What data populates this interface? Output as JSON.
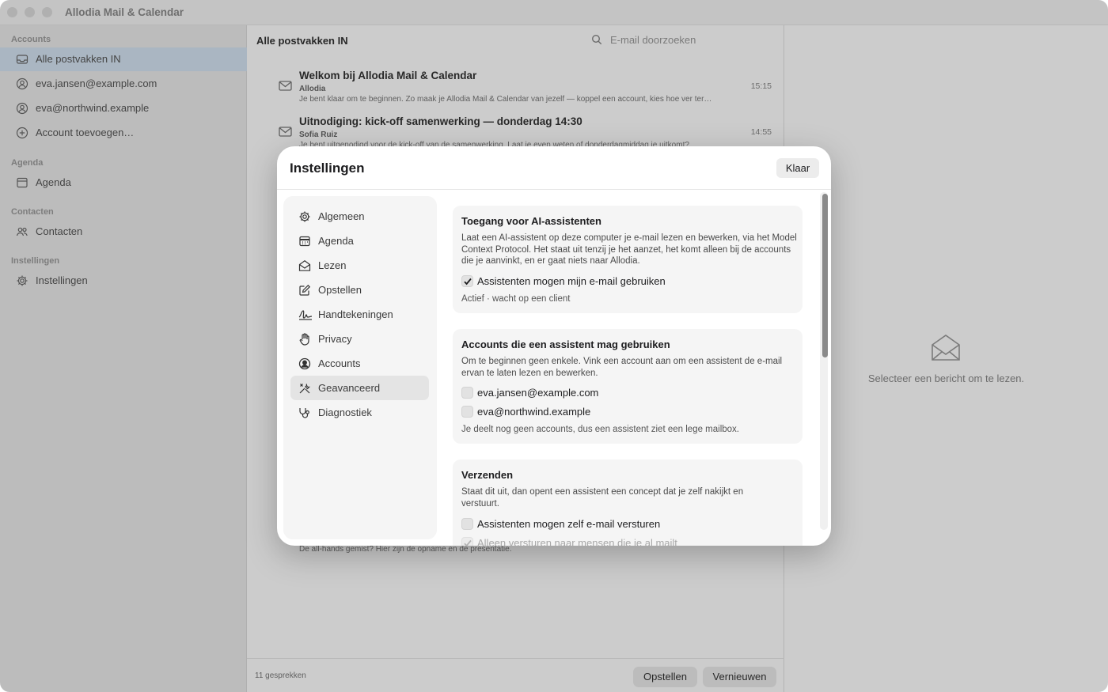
{
  "window": {
    "title": "Allodia Mail & Calendar"
  },
  "sidebar": {
    "sections": [
      {
        "label": "Accounts",
        "items": [
          {
            "label": "Alle postvakken IN",
            "icon": "inbox-icon",
            "selected": true
          },
          {
            "label": "eva.jansen@example.com",
            "icon": "person-icon"
          },
          {
            "label": "eva@northwind.example",
            "icon": "person-icon"
          },
          {
            "label": "Account toevoegen…",
            "icon": "plus-circle-icon"
          }
        ]
      },
      {
        "label": "Agenda",
        "items": [
          {
            "label": "Agenda",
            "icon": "calendar-icon"
          }
        ]
      },
      {
        "label": "Contacten",
        "items": [
          {
            "label": "Contacten",
            "icon": "people-icon"
          }
        ]
      },
      {
        "label": "Instellingen",
        "items": [
          {
            "label": "Instellingen",
            "icon": "gear-icon"
          }
        ]
      }
    ]
  },
  "list": {
    "title": "Alle postvakken IN",
    "search_placeholder": "E-mail doorzoeken",
    "messages": [
      {
        "subject": "Welkom bij Allodia Mail & Calendar",
        "from": "Allodia",
        "preview": "Je bent klaar om te beginnen. Zo maak je Allodia Mail & Calendar van jezelf — koppel een account, kies hoe ver ter…",
        "time": "15:15"
      },
      {
        "subject": "Uitnodiging: kick-off samenwerking — donderdag 14:30",
        "from": "Sofia Ruiz",
        "preview": "Je bent uitgenodigd voor de kick-off van de samenwerking. Laat je even weten of donderdagmiddag je uitkomt?",
        "time": "14:55"
      }
    ],
    "last_preview": "De all-hands gemist? Hier zijn de opname en de presentatie.",
    "count": "11 gesprekken",
    "compose_label": "Opstellen",
    "refresh_label": "Vernieuwen"
  },
  "reader": {
    "empty_label": "Selecteer een bericht om te lezen.",
    "icon": "open-envelope-icon"
  },
  "settings": {
    "title": "Instellingen",
    "done_label": "Klaar",
    "nav": [
      {
        "label": "Algemeen",
        "icon": "gear-icon"
      },
      {
        "label": "Agenda",
        "icon": "calendar-icon"
      },
      {
        "label": "Lezen",
        "icon": "open-envelope-icon"
      },
      {
        "label": "Opstellen",
        "icon": "compose-icon"
      },
      {
        "label": "Handtekeningen",
        "icon": "signature-icon"
      },
      {
        "label": "Privacy",
        "icon": "hand-icon"
      },
      {
        "label": "Accounts",
        "icon": "person-circle-icon"
      },
      {
        "label": "Geavanceerd",
        "icon": "tools-icon",
        "selected": true
      },
      {
        "label": "Diagnostiek",
        "icon": "stethoscope-icon"
      }
    ],
    "cards": {
      "ai_access": {
        "title": "Toegang voor AI-assistenten",
        "desc": "Laat een AI-assistent op deze computer je e-mail lezen en bewerken, via het Model Context Protocol. Het staat uit tenzij je het aanzet, het komt alleen bij de accounts die je aanvinkt, en er gaat niets naar Allodia.",
        "checkbox_label": "Assistenten mogen mijn e-mail gebruiken",
        "checkbox_checked": true,
        "status": "Actief · wacht op een client"
      },
      "accounts": {
        "title": "Accounts die een assistent mag gebruiken",
        "desc": "Om te beginnen geen enkele. Vink een account aan om een assistent de e-mail ervan te laten lezen en bewerken.",
        "accounts": [
          {
            "label": "eva.jansen@example.com",
            "checked": false
          },
          {
            "label": "eva@northwind.example",
            "checked": false
          }
        ],
        "note": "Je deelt nog geen accounts, dus een assistent ziet een lege mailbox."
      },
      "sending": {
        "title": "Verzenden",
        "desc": "Staat dit uit, dan opent een assistent een concept dat je zelf nakijkt en verstuurt.",
        "checkbox_label": "Assistenten mogen zelf e-mail versturen",
        "checkbox_checked": false,
        "sub_label": "Alleen versturen naar mensen die je al mailt",
        "sub_checked": true
      }
    }
  }
}
